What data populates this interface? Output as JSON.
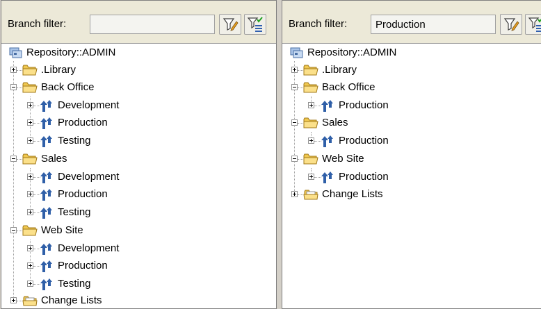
{
  "left_panel": {
    "filter_label": "Branch filter:",
    "filter_value": "",
    "root_label": "Repository::ADMIN",
    "nodes": [
      {
        "label": ".Library"
      },
      {
        "label": "Back Office"
      },
      {
        "label": "Development"
      },
      {
        "label": "Production"
      },
      {
        "label": "Testing"
      },
      {
        "label": "Sales"
      },
      {
        "label": "Development"
      },
      {
        "label": "Production"
      },
      {
        "label": "Testing"
      },
      {
        "label": "Web Site"
      },
      {
        "label": "Development"
      },
      {
        "label": "Production"
      },
      {
        "label": "Testing"
      },
      {
        "label": "Change Lists"
      }
    ]
  },
  "right_panel": {
    "filter_label": "Branch filter:",
    "filter_value": "Production",
    "root_label": "Repository::ADMIN",
    "nodes": [
      {
        "label": ".Library"
      },
      {
        "label": "Back Office"
      },
      {
        "label": "Production"
      },
      {
        "label": "Sales"
      },
      {
        "label": "Production"
      },
      {
        "label": "Web Site"
      },
      {
        "label": "Production"
      },
      {
        "label": "Change Lists"
      }
    ]
  }
}
